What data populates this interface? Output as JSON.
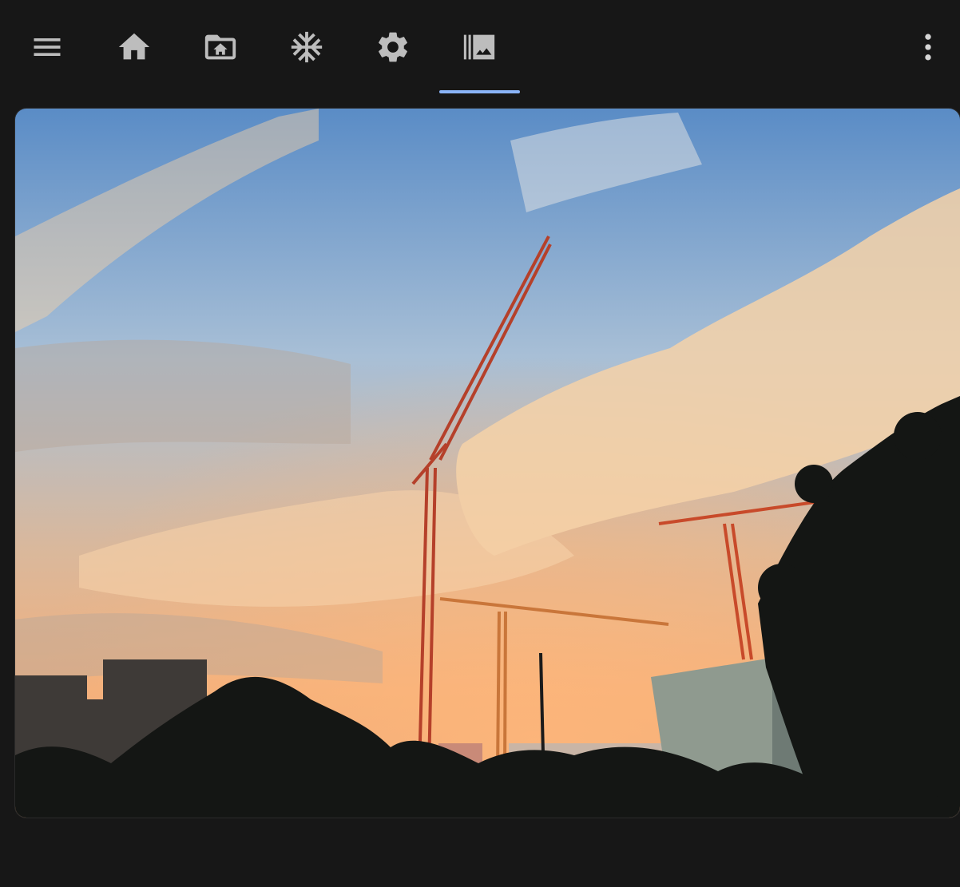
{
  "toolbar": {
    "items": [
      {
        "icon": "menu-icon",
        "selected": false
      },
      {
        "icon": "home-icon",
        "selected": false
      },
      {
        "icon": "folder-home-icon",
        "selected": false
      },
      {
        "icon": "snowflake-icon",
        "selected": false
      },
      {
        "icon": "gear-icon",
        "selected": false
      },
      {
        "icon": "photo-library-icon",
        "selected": true
      }
    ],
    "overflow_icon": "more-vertical-icon",
    "indicator_color": "#8ab4f8"
  },
  "photo": {
    "subject": "sunset-cranes",
    "colors": {
      "sky_top": "#5a8cc6",
      "sky_mid": "#a8bfd6",
      "horizon": "#f3b07c",
      "cloud": "#f6d2a8",
      "silhouette": "#141614",
      "crane": "#c84a2a"
    }
  }
}
